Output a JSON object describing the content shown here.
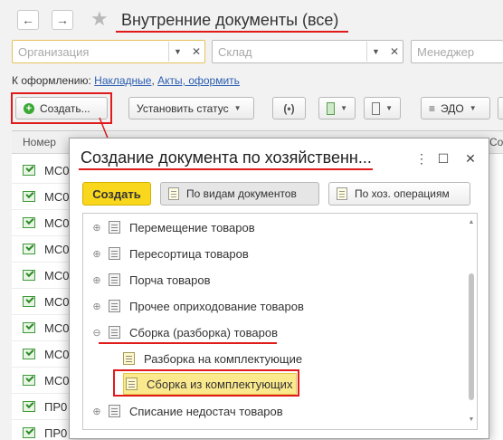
{
  "window": {
    "title": "Внутренние документы (все)",
    "back_icon": "←",
    "forward_icon": "→",
    "star_icon": "★"
  },
  "filters": {
    "org_placeholder": "Организация",
    "warehouse_placeholder": "Склад",
    "manager_placeholder": "Менеджер"
  },
  "draft": {
    "label": "К оформлению:",
    "link_invoices": "Накладные",
    "separator": ", ",
    "link_acts": "Акты, оформить"
  },
  "toolbar": {
    "create_label": "Создать...",
    "set_status_label": "Установить статус",
    "edo_label": "ЭДО"
  },
  "list": {
    "col_number": "Номер",
    "col_status": "Сост",
    "rows": [
      "МС0",
      "МС0",
      "МС0",
      "МС0",
      "МС0",
      "МС0",
      "МС0",
      "МС0",
      "МС0",
      "ПР0",
      "ПР0"
    ]
  },
  "dialog": {
    "title": "Создание документа по хозяйственн...",
    "create_label": "Создать",
    "by_doc_types_label": "По видам документов",
    "by_operations_label": "По хоз. операциям",
    "tree": {
      "items": [
        {
          "label": "Перемещение товаров",
          "expander": "⊕"
        },
        {
          "label": "Пересортица товаров",
          "expander": "⊕"
        },
        {
          "label": "Порча товаров",
          "expander": "⊕"
        },
        {
          "label": "Прочее оприходование товаров",
          "expander": "⊕"
        },
        {
          "label": "Сборка (разборка) товаров",
          "expander": "⊖"
        },
        {
          "label": "Разборка на комплектующие",
          "expander": ""
        },
        {
          "label": "Сборка из комплектующих",
          "expander": ""
        },
        {
          "label": "Списание недостач товаров",
          "expander": "⊕"
        }
      ]
    }
  },
  "colors": {
    "accent_yellow": "#f9d71c",
    "annotation_red": "#e01b1b",
    "selection": "#fbe98e",
    "link": "#2a5db0"
  }
}
